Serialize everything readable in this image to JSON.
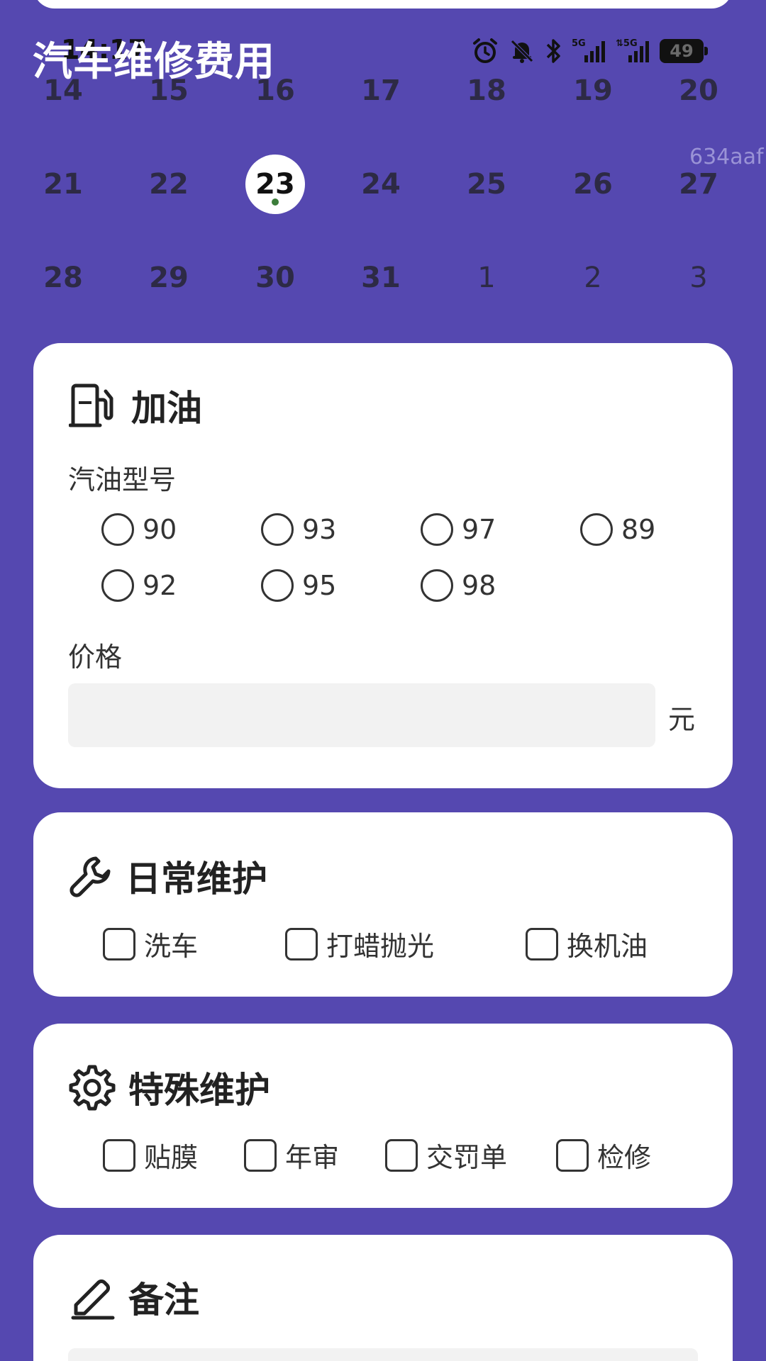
{
  "status_bar": {
    "time": "14:17",
    "battery": "49",
    "icons": [
      "alarm-icon",
      "bell-off-icon",
      "bluetooth-icon",
      "signal-5g-icon",
      "signal-5g-icon-2",
      "battery-icon"
    ]
  },
  "app": {
    "title": "汽车维修费用"
  },
  "calendar": {
    "watermark": "634aaf",
    "rows": [
      [
        {
          "d": "14"
        },
        {
          "d": "15"
        },
        {
          "d": "16"
        },
        {
          "d": "17"
        },
        {
          "d": "18"
        },
        {
          "d": "19"
        },
        {
          "d": "20"
        }
      ],
      [
        {
          "d": "21"
        },
        {
          "d": "22"
        },
        {
          "d": "23",
          "selected": true
        },
        {
          "d": "24"
        },
        {
          "d": "25"
        },
        {
          "d": "26"
        },
        {
          "d": "27"
        }
      ],
      [
        {
          "d": "28"
        },
        {
          "d": "29"
        },
        {
          "d": "30"
        },
        {
          "d": "31"
        },
        {
          "d": "1",
          "other": true
        },
        {
          "d": "2",
          "other": true
        },
        {
          "d": "3",
          "other": true
        }
      ]
    ]
  },
  "fuel": {
    "title": "加油",
    "grade_label": "汽油型号",
    "grades": [
      "90",
      "93",
      "97",
      "89",
      "92",
      "95",
      "98"
    ],
    "price_label": "价格",
    "price_value": "",
    "price_unit": "元"
  },
  "daily": {
    "title": "日常维护",
    "options": [
      "洗车",
      "打蜡抛光",
      "换机油"
    ]
  },
  "special": {
    "title": "特殊维护",
    "options": [
      "贴膜",
      "年审",
      "交罚单",
      "检修"
    ]
  },
  "notes": {
    "title": "备注",
    "value": ""
  },
  "colors": {
    "background": "#5548B0",
    "card": "#FFFFFF",
    "input": "#F2F2F2",
    "selected_dot": "#3C7D3A"
  }
}
